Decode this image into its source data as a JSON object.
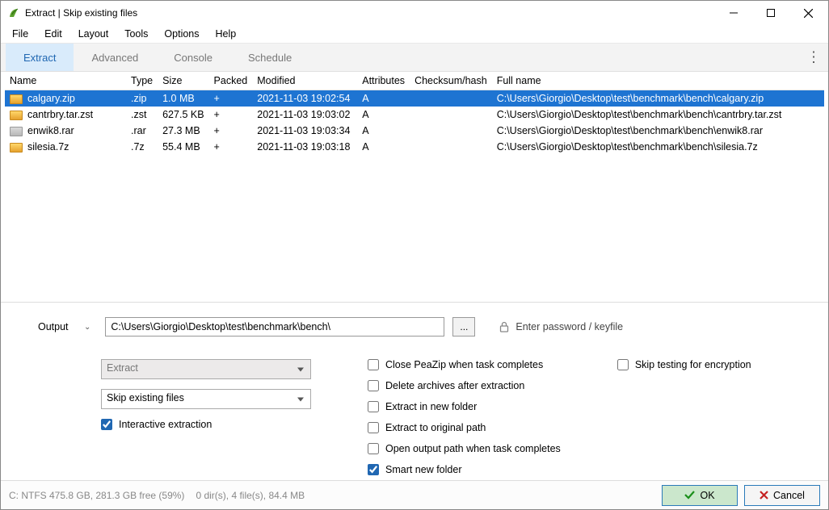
{
  "window": {
    "title": "Extract | Skip existing files"
  },
  "menu": {
    "file": "File",
    "edit": "Edit",
    "layout": "Layout",
    "tools": "Tools",
    "options": "Options",
    "help": "Help"
  },
  "tabs": {
    "extract": "Extract",
    "advanced": "Advanced",
    "console": "Console",
    "schedule": "Schedule"
  },
  "columns": {
    "name": "Name",
    "type": "Type",
    "size": "Size",
    "packed": "Packed",
    "modified": "Modified",
    "attributes": "Attributes",
    "checksum": "Checksum/hash",
    "fullname": "Full name"
  },
  "files": [
    {
      "name": "calgary.zip",
      "type": ".zip",
      "size": "1.0 MB",
      "packed": "+",
      "modified": "2021-11-03 19:02:54",
      "attributes": "A",
      "checksum": "",
      "fullname": "C:\\Users\\Giorgio\\Desktop\\test\\benchmark\\bench\\calgary.zip"
    },
    {
      "name": "cantrbry.tar.zst",
      "type": ".zst",
      "size": "627.5 KB",
      "packed": "+",
      "modified": "2021-11-03 19:03:02",
      "attributes": "A",
      "checksum": "",
      "fullname": "C:\\Users\\Giorgio\\Desktop\\test\\benchmark\\bench\\cantrbry.tar.zst"
    },
    {
      "name": "enwik8.rar",
      "type": ".rar",
      "size": "27.3 MB",
      "packed": "+",
      "modified": "2021-11-03 19:03:34",
      "attributes": "A",
      "checksum": "",
      "fullname": "C:\\Users\\Giorgio\\Desktop\\test\\benchmark\\bench\\enwik8.rar"
    },
    {
      "name": "silesia.7z",
      "type": ".7z",
      "size": "55.4 MB",
      "packed": "+",
      "modified": "2021-11-03 19:03:18",
      "attributes": "A",
      "checksum": "",
      "fullname": "C:\\Users\\Giorgio\\Desktop\\test\\benchmark\\bench\\silesia.7z"
    }
  ],
  "output": {
    "label": "Output",
    "path": "C:\\Users\\Giorgio\\Desktop\\test\\benchmark\\bench\\",
    "browse": "...",
    "password": "Enter password / keyfile"
  },
  "selects": {
    "action": "Extract",
    "naming": "Skip existing files"
  },
  "checks": {
    "interactive": "Interactive extraction",
    "closeOnDone": "Close PeaZip when task completes",
    "deleteAfter": "Delete archives after extraction",
    "newFolder": "Extract in new folder",
    "originalPath": "Extract to original path",
    "openOutput": "Open output path when task completes",
    "smartFolder": "Smart new folder",
    "skipTest": "Skip testing for encryption"
  },
  "status": {
    "disk": "C: NTFS 475.8 GB, 281.3 GB free (59%)",
    "count": "0 dir(s), 4 file(s), 84.4 MB"
  },
  "buttons": {
    "ok": "OK",
    "cancel": "Cancel"
  }
}
